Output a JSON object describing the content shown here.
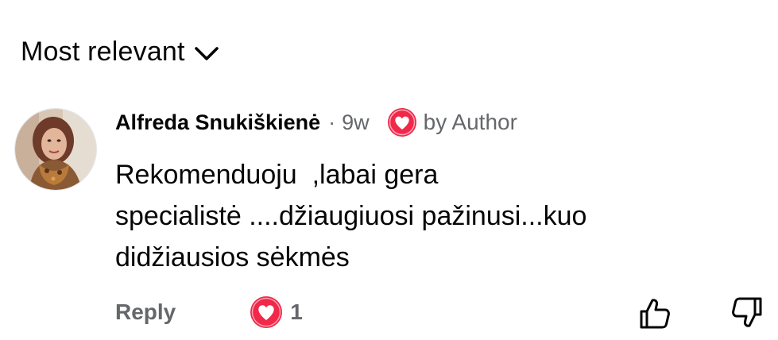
{
  "sort": {
    "label": "Most relevant",
    "icon": "chevron-down-icon"
  },
  "comment": {
    "author": "Alfreda Snukiškienė",
    "separator": "·",
    "time": "9w",
    "badge_icon": "heart-icon",
    "badge_label": "by Author",
    "text": "Rekomenduoju  ,labai gera\nspecialistė ....džiaugiuosi pažinusi...kuo\ndidžiausios sėkmės",
    "reply_label": "Reply",
    "reaction_icon": "heart-icon",
    "reaction_count": "1",
    "upvote_icon": "thumbs-up-icon",
    "downvote_icon": "thumbs-down-icon"
  },
  "colors": {
    "heart": "#f0284a",
    "secondary_text": "#65676b",
    "primary_text": "#050505"
  }
}
